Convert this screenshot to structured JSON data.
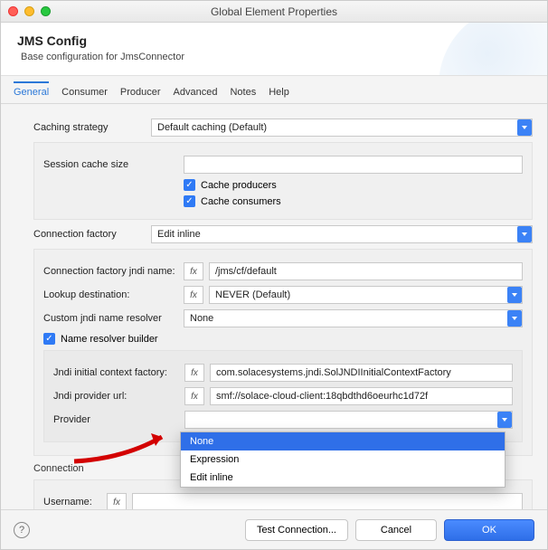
{
  "window": {
    "title": "Global Element Properties"
  },
  "header": {
    "title": "JMS Config",
    "subtitle": "Base configuration for JmsConnector"
  },
  "tabs": [
    "General",
    "Consumer",
    "Producer",
    "Advanced",
    "Notes",
    "Help"
  ],
  "caching": {
    "label": "Caching strategy",
    "value": "Default caching (Default)",
    "session_cache_label": "Session cache size",
    "session_cache_value": "",
    "cache_producers_label": "Cache producers",
    "cache_consumers_label": "Cache consumers"
  },
  "connfactory": {
    "label": "Connection factory",
    "value": "Edit inline",
    "jndi_name_label": "Connection factory jndi name:",
    "jndi_name_value": "/jms/cf/default",
    "lookup_label": "Lookup destination:",
    "lookup_value": "NEVER (Default)",
    "resolver_label": "Custom jndi name resolver",
    "resolver_value": "None",
    "builder_label": "Name resolver builder",
    "ctx_label": "Jndi initial context factory:",
    "ctx_value": "com.solacesystems.jndi.SolJNDIInitialContextFactory",
    "url_label": "Jndi provider url:",
    "url_value": "smf://solace-cloud-client:18qbdthd6oeurhc1d72f",
    "provider_label": "Provider"
  },
  "dropdown": {
    "opt1": "None",
    "opt2": "Expression",
    "opt3": "Edit inline"
  },
  "connection": {
    "label": "Connection",
    "username_label": "Username:",
    "username_value": ""
  },
  "footer": {
    "test": "Test Connection...",
    "cancel": "Cancel",
    "ok": "OK"
  },
  "fx_label": "fx",
  "help_label": "?"
}
